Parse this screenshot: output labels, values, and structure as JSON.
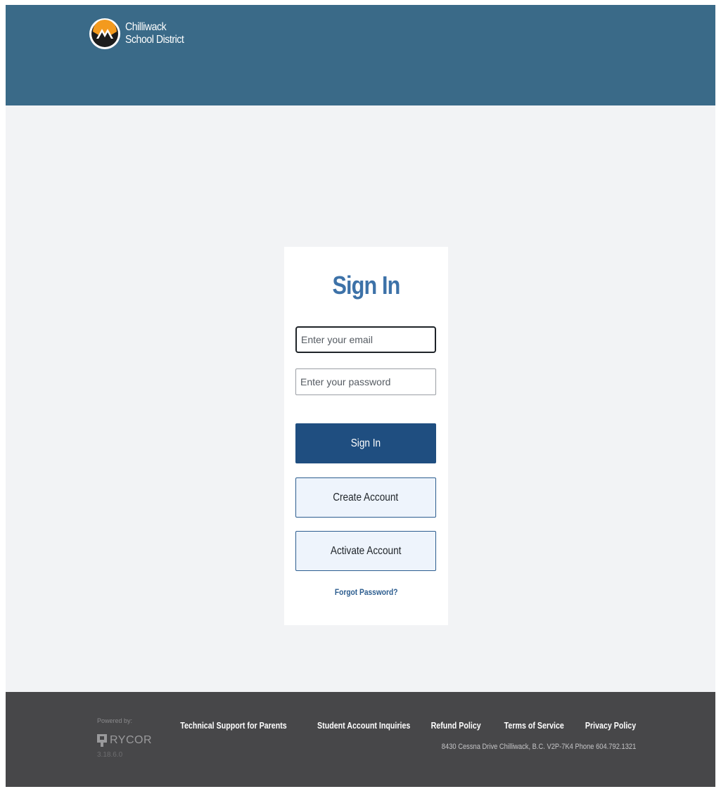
{
  "header": {
    "logo_line1": "Chilliwack",
    "logo_line2": "School District",
    "logo_icon": "chilliwack-sd-logo-icon",
    "background": "#3a6a88"
  },
  "signin": {
    "title": "Sign In",
    "email_placeholder": "Enter your email",
    "email_value": "",
    "password_placeholder": "Enter your password",
    "password_value": "",
    "signin_button": "Sign In",
    "create_button": "Create Account",
    "activate_button": "Activate Account",
    "forgot_link": "Forgot Password?",
    "accent": "#3d72a8",
    "primary_button_color": "#1f4e80"
  },
  "footer": {
    "powered_by": "Powered by:",
    "brand": "RYCOR",
    "version": "3.18.6.0",
    "links": [
      "Technical Support for Parents",
      "Student Account Inquiries",
      "Refund Policy",
      "Terms of Service",
      "Privacy Policy"
    ],
    "address": "8430 Cessna Drive Chilliwack, B.C. V2P-7K4 Phone 604.792.1321",
    "background": "#474749"
  }
}
